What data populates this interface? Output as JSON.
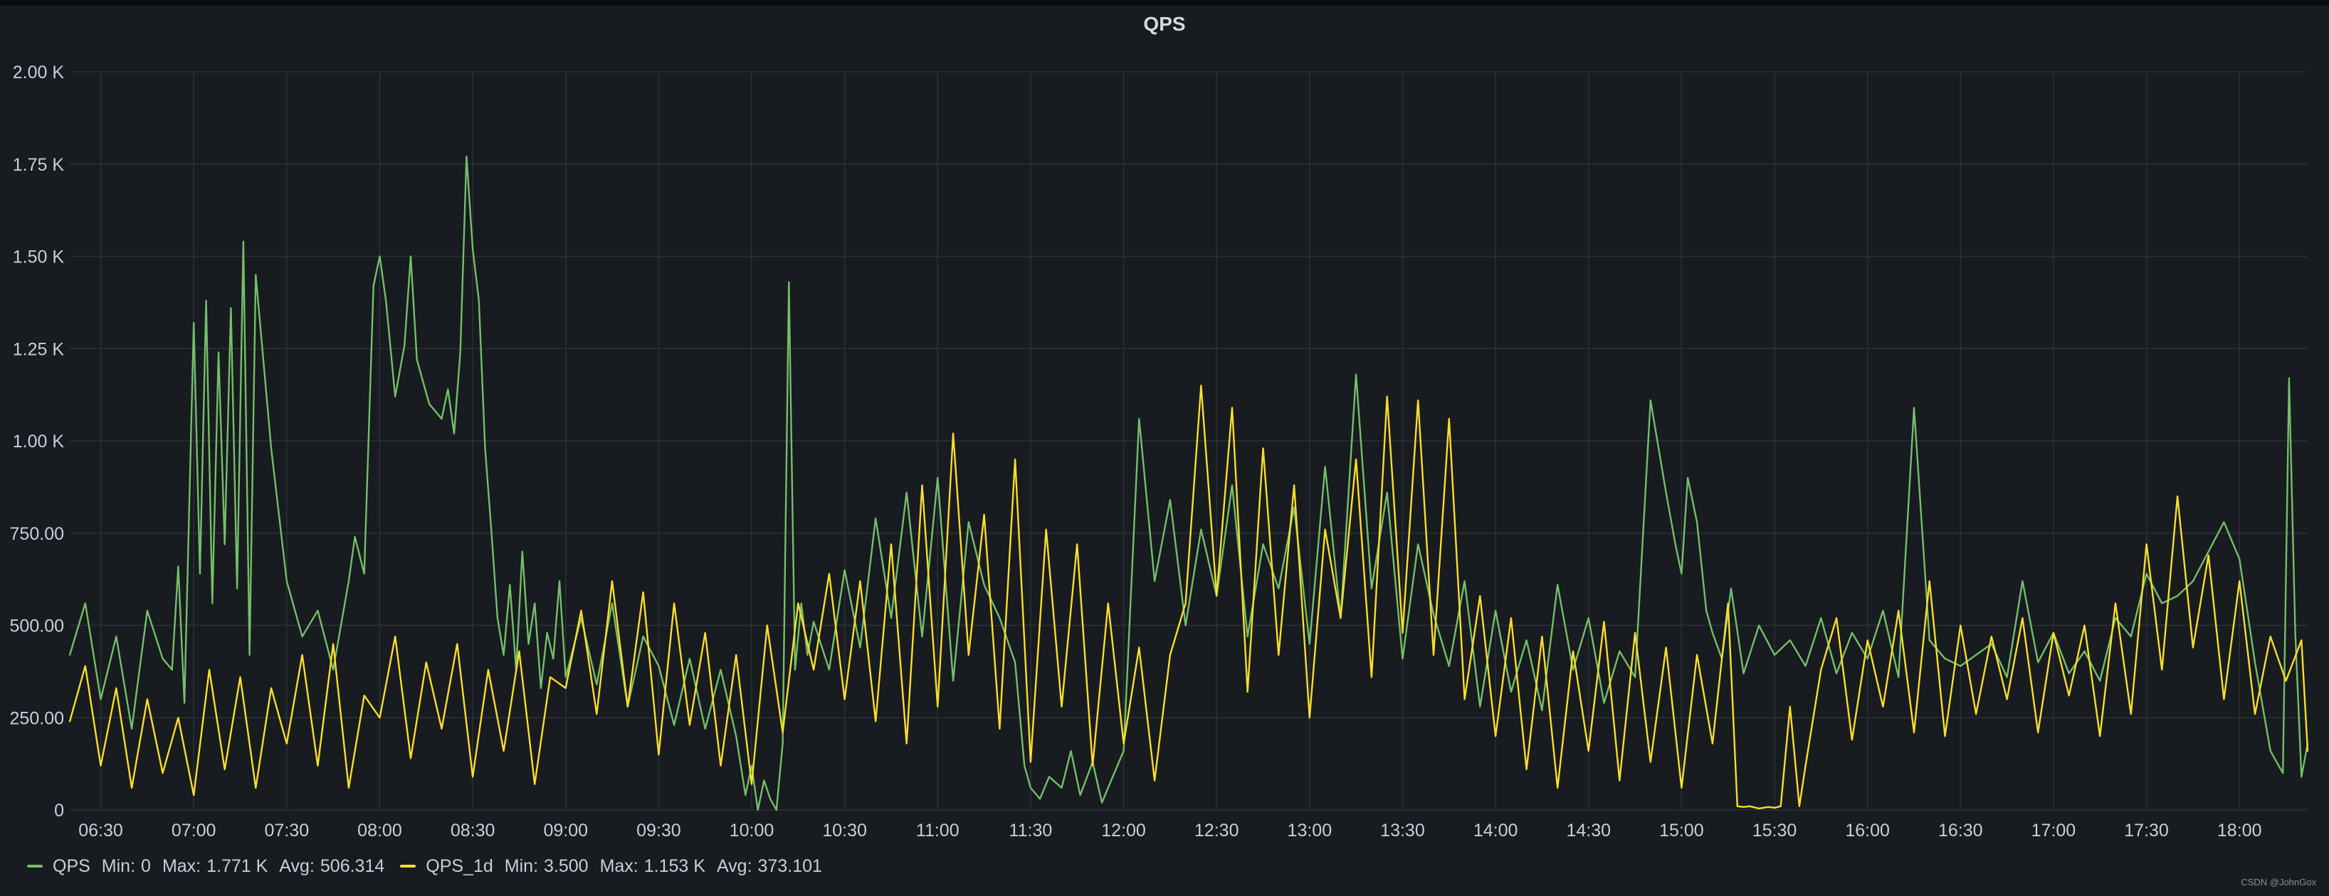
{
  "panel": {
    "title": "QPS"
  },
  "colors": {
    "series_qps": "#73bf69",
    "series_qps_1d": "#fade2a",
    "grid": "#2c3038",
    "background": "#181b1f"
  },
  "legend": {
    "items": [
      {
        "name": "QPS",
        "min_label": "Min:",
        "min": "0",
        "max_label": "Max:",
        "max": "1.771 K",
        "avg_label": "Avg:",
        "avg": "506.314"
      },
      {
        "name": "QPS_1d",
        "min_label": "Min:",
        "min": "3.500",
        "max_label": "Max:",
        "max": "1.153 K",
        "avg_label": "Avg:",
        "avg": "373.101"
      }
    ]
  },
  "watermark": "CSDN @JohnGox",
  "chart_data": {
    "type": "line",
    "title": "QPS",
    "ylim": [
      0,
      2000
    ],
    "y_ticks": [
      0,
      250,
      500,
      750,
      1000,
      1250,
      1500,
      1750,
      2000
    ],
    "y_tick_labels": [
      "0",
      "250.00",
      "500.00",
      "750.00",
      "1.00 K",
      "1.25 K",
      "1.50 K",
      "1.75 K",
      "2.00 K"
    ],
    "x_range_minutes": [
      380,
      1102
    ],
    "x_ticks": [
      390,
      420,
      450,
      480,
      510,
      540,
      570,
      600,
      630,
      660,
      690,
      720,
      750,
      780,
      810,
      840,
      870,
      900,
      930,
      960,
      990,
      1020,
      1050,
      1080
    ],
    "x_tick_labels": [
      "06:30",
      "07:00",
      "07:30",
      "08:00",
      "08:30",
      "09:00",
      "09:30",
      "10:00",
      "10:30",
      "11:00",
      "11:30",
      "12:00",
      "12:30",
      "13:00",
      "13:30",
      "14:00",
      "14:30",
      "15:00",
      "15:30",
      "16:00",
      "16:30",
      "17:00",
      "17:30",
      "18:00"
    ],
    "x_label_format": "HH:MM",
    "grid": true,
    "legend_position": "bottom-left",
    "series": [
      {
        "name": "QPS",
        "color": "#73bf69",
        "x": [
          380,
          385,
          390,
          395,
          400,
          405,
          410,
          413,
          415,
          417,
          420,
          422,
          424,
          426,
          428,
          430,
          432,
          434,
          436,
          438,
          440,
          445,
          450,
          455,
          460,
          465,
          470,
          472,
          475,
          478,
          480,
          482,
          485,
          488,
          490,
          492,
          494,
          496,
          498,
          500,
          502,
          504,
          506,
          508,
          510,
          512,
          514,
          516,
          518,
          520,
          522,
          524,
          526,
          528,
          530,
          532,
          534,
          536,
          538,
          540,
          545,
          550,
          555,
          560,
          565,
          570,
          575,
          580,
          585,
          590,
          595,
          598,
          600,
          602,
          604,
          606,
          608,
          610,
          612,
          614,
          616,
          618,
          620,
          625,
          630,
          635,
          640,
          645,
          650,
          655,
          660,
          665,
          670,
          675,
          680,
          685,
          688,
          690,
          693,
          696,
          700,
          703,
          706,
          710,
          713,
          716,
          720,
          725,
          730,
          735,
          740,
          745,
          750,
          755,
          760,
          765,
          770,
          775,
          780,
          785,
          790,
          795,
          800,
          805,
          810,
          815,
          820,
          825,
          830,
          835,
          840,
          845,
          850,
          855,
          860,
          865,
          870,
          875,
          880,
          885,
          890,
          895,
          898,
          900,
          902,
          905,
          908,
          910,
          913,
          916,
          920,
          925,
          930,
          935,
          940,
          945,
          950,
          955,
          960,
          965,
          970,
          975,
          980,
          985,
          990,
          995,
          1000,
          1005,
          1010,
          1015,
          1020,
          1025,
          1030,
          1035,
          1040,
          1045,
          1050,
          1055,
          1060,
          1065,
          1070,
          1075,
          1080,
          1085,
          1090,
          1094,
          1096,
          1098,
          1100,
          1102
        ],
        "values": [
          420,
          560,
          300,
          470,
          220,
          540,
          410,
          380,
          660,
          290,
          1320,
          640,
          1380,
          560,
          1240,
          720,
          1360,
          600,
          1540,
          420,
          1450,
          980,
          620,
          470,
          540,
          380,
          620,
          740,
          640,
          1420,
          1500,
          1380,
          1120,
          1260,
          1500,
          1220,
          1160,
          1100,
          1080,
          1060,
          1140,
          1020,
          1240,
          1771,
          1520,
          1380,
          980,
          760,
          520,
          420,
          610,
          380,
          700,
          450,
          560,
          330,
          480,
          410,
          620,
          360,
          520,
          340,
          560,
          280,
          470,
          390,
          230,
          410,
          220,
          380,
          200,
          40,
          120,
          0,
          80,
          30,
          0,
          180,
          1430,
          380,
          560,
          420,
          510,
          380,
          650,
          440,
          790,
          520,
          860,
          470,
          900,
          350,
          780,
          610,
          520,
          400,
          120,
          60,
          30,
          90,
          60,
          160,
          40,
          130,
          20,
          80,
          160,
          1060,
          620,
          840,
          500,
          760,
          580,
          880,
          470,
          720,
          600,
          820,
          450,
          930,
          520,
          1180,
          600,
          860,
          410,
          720,
          530,
          390,
          620,
          280,
          540,
          320,
          460,
          270,
          610,
          380,
          520,
          290,
          430,
          360,
          1110,
          860,
          720,
          640,
          900,
          780,
          540,
          480,
          410,
          600,
          370,
          500,
          420,
          460,
          390,
          520,
          370,
          480,
          410,
          540,
          360,
          1090,
          460,
          410,
          390,
          420,
          450,
          360,
          620,
          400,
          480,
          370,
          430,
          350,
          520,
          470,
          640,
          560,
          580,
          620,
          700,
          780,
          680,
          400,
          160,
          100,
          1170,
          480,
          90,
          180
        ]
      },
      {
        "name": "QPS_1d",
        "color": "#fade2a",
        "x": [
          380,
          385,
          390,
          395,
          400,
          405,
          410,
          415,
          420,
          425,
          430,
          435,
          440,
          445,
          450,
          455,
          460,
          465,
          470,
          475,
          480,
          485,
          490,
          495,
          500,
          505,
          510,
          515,
          520,
          525,
          530,
          535,
          540,
          545,
          550,
          555,
          560,
          565,
          570,
          575,
          580,
          585,
          590,
          595,
          600,
          605,
          610,
          615,
          620,
          625,
          630,
          635,
          640,
          645,
          650,
          655,
          660,
          665,
          670,
          675,
          680,
          685,
          690,
          695,
          700,
          705,
          710,
          715,
          720,
          725,
          730,
          735,
          740,
          745,
          750,
          755,
          760,
          765,
          770,
          775,
          780,
          785,
          790,
          795,
          800,
          805,
          810,
          815,
          820,
          825,
          830,
          835,
          840,
          845,
          850,
          855,
          860,
          865,
          870,
          875,
          880,
          885,
          890,
          895,
          900,
          905,
          910,
          915,
          918,
          920,
          922,
          925,
          928,
          930,
          932,
          935,
          938,
          940,
          945,
          950,
          955,
          960,
          965,
          970,
          975,
          980,
          985,
          990,
          995,
          1000,
          1005,
          1010,
          1015,
          1020,
          1025,
          1030,
          1035,
          1040,
          1045,
          1050,
          1055,
          1060,
          1065,
          1070,
          1075,
          1080,
          1085,
          1090,
          1095,
          1100,
          1102
        ],
        "values": [
          240,
          390,
          120,
          330,
          60,
          300,
          100,
          250,
          40,
          380,
          110,
          360,
          60,
          330,
          180,
          420,
          120,
          450,
          60,
          310,
          250,
          470,
          140,
          400,
          220,
          450,
          90,
          380,
          160,
          430,
          70,
          360,
          330,
          540,
          260,
          620,
          280,
          590,
          150,
          560,
          230,
          480,
          120,
          420,
          70,
          500,
          210,
          560,
          380,
          640,
          300,
          620,
          240,
          720,
          180,
          880,
          280,
          1020,
          420,
          800,
          220,
          950,
          130,
          760,
          280,
          720,
          120,
          560,
          180,
          440,
          80,
          420,
          560,
          1150,
          580,
          1090,
          320,
          980,
          420,
          880,
          250,
          760,
          520,
          950,
          360,
          1120,
          480,
          1110,
          420,
          1060,
          300,
          580,
          200,
          520,
          110,
          470,
          60,
          430,
          160,
          510,
          80,
          480,
          130,
          440,
          60,
          420,
          180,
          560,
          10,
          8,
          10,
          4,
          8,
          6,
          10,
          280,
          10,
          120,
          380,
          520,
          190,
          460,
          280,
          540,
          210,
          620,
          200,
          500,
          260,
          470,
          300,
          520,
          210,
          480,
          310,
          500,
          200,
          560,
          260,
          720,
          380,
          850,
          440,
          690,
          300,
          620,
          260,
          470,
          350,
          460,
          160
        ]
      }
    ]
  }
}
